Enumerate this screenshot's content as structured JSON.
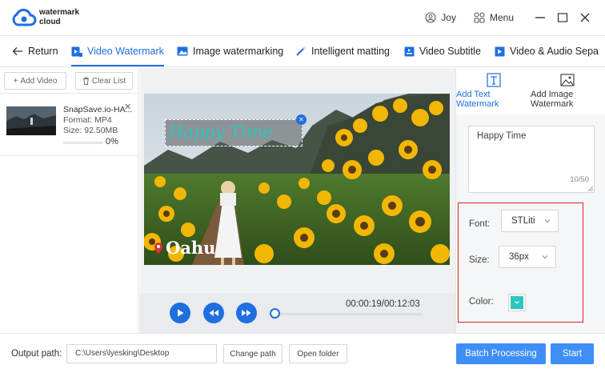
{
  "app": {
    "logo_line1": "watermark",
    "logo_line2": "cloud"
  },
  "titlebar": {
    "user": "Joy",
    "menu_label": "Menu"
  },
  "tabs": [
    {
      "label": "Return",
      "icon": "arrow-left-icon"
    },
    {
      "label": "Video Watermark",
      "icon": "video-icon",
      "active": true
    },
    {
      "label": "Image watermarking",
      "icon": "image-icon"
    },
    {
      "label": "Intelligent matting",
      "icon": "magic-wand-icon"
    },
    {
      "label": "Video Subtitle",
      "icon": "video-subtitle-icon"
    },
    {
      "label": "Video & Audio Sepa",
      "icon": "video-audio-icon"
    }
  ],
  "left": {
    "add_video": "Add Video",
    "clear_list": "Clear List",
    "file": {
      "name": "SnapSave.io-HA...",
      "format": "Format:  MP4",
      "size": "Size:  92.50MB",
      "progress": "0%",
      "progress_value": 0
    }
  },
  "preview": {
    "watermark_text": "Happy Time",
    "overlay_text": "Oahu",
    "timecode": "00:00:19/00:12:03",
    "playback_fraction": 0.026
  },
  "right": {
    "tab_text": "Add Text Watermark",
    "tab_image": "Add Image Watermark",
    "text_value": "Happy Time",
    "char_count": "10/50",
    "font_label": "Font:",
    "font_value": "STLiti",
    "size_label": "Size:",
    "size_value": "36px",
    "color_label": "Color:",
    "color_value": "#2ec5c1"
  },
  "bottom": {
    "output_label": "Output path:",
    "output_path": "C:\\Users\\lyesking\\Desktop",
    "change_path": "Change path",
    "open_folder": "Open folder",
    "batch": "Batch Processing",
    "start": "Start"
  },
  "colors": {
    "accent": "#1f6fe0",
    "primary_button": "#3e8ef7",
    "highlight_border": "#e02020"
  }
}
